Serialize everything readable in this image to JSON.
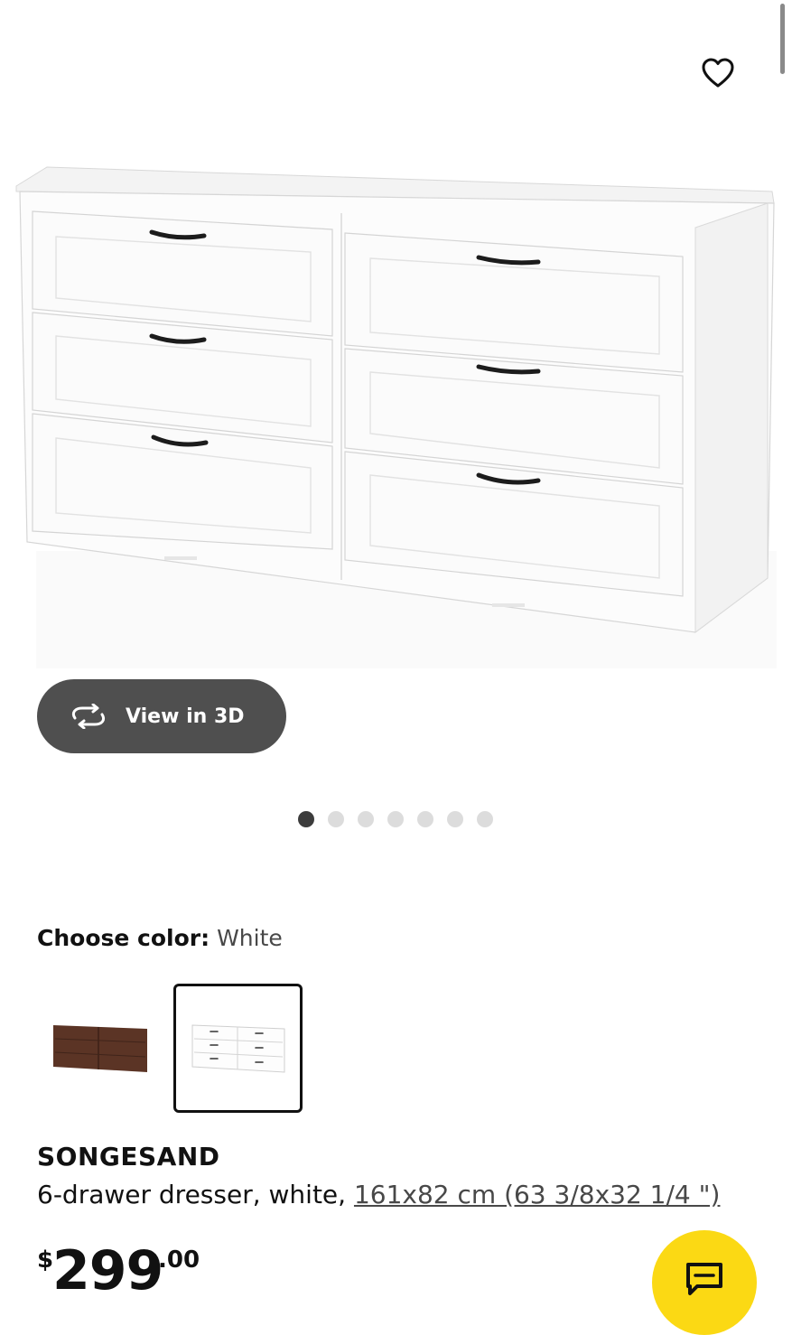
{
  "product": {
    "name": "SONGESAND",
    "description": "6-drawer dresser, white,",
    "dimensions": "161x82 cm (63 3/8x32 1/4 \")",
    "price": {
      "currency": "$",
      "integer": "299",
      "decimal": ".00"
    }
  },
  "gallery": {
    "view3d_label": "View in 3D",
    "dot_count": 7,
    "active_index": 0
  },
  "color": {
    "label": "Choose color:",
    "value": "White",
    "options_selected_index": 1
  },
  "colors": {
    "chat_button": "#fbd914",
    "pill": "#4f4f4f",
    "brown": "#5b3425"
  }
}
